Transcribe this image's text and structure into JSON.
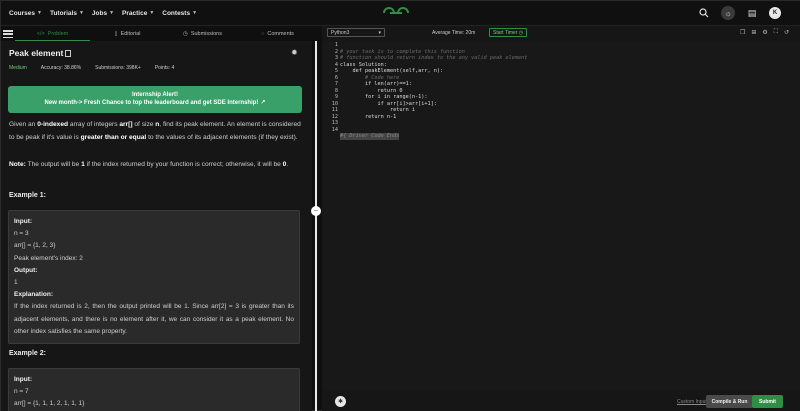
{
  "nav": {
    "items": [
      "Courses",
      "Tutorials",
      "Jobs",
      "Practice",
      "Contests"
    ],
    "logo_text": "GfG",
    "avatar_letter": "K"
  },
  "tabs": [
    {
      "label": "Problem",
      "icon": "code-icon"
    },
    {
      "label": "Editorial",
      "icon": "book-icon"
    },
    {
      "label": "Submissions",
      "icon": "clock-icon"
    },
    {
      "label": "Comments",
      "icon": "comment-icon"
    }
  ],
  "problem": {
    "title": "Peak element",
    "difficulty": "Medium",
    "accuracy": "Accuracy: 38.86%",
    "submissions": "Submissions: 398K+",
    "points": "Points: 4"
  },
  "banner": {
    "line1": "Internship Alert!",
    "line2": "New month-> Fresh Chance to top the leaderboard and get SDE Internship!"
  },
  "description": {
    "p1_a": "Given an ",
    "p1_b": "0-indexed",
    "p1_c": " array of integers ",
    "p1_d": "arr[]",
    "p1_e": " of size ",
    "p1_f": "n",
    "p1_g": ", find its peak element. An element is considered to be peak if it's value is ",
    "p1_h": "greater than or equal",
    "p1_i": " to the values of its adjacent elements (if they exist).",
    "note_label": "Note:",
    "note_a": " The output will be ",
    "note_b": "1",
    "note_c": " if the index returned by your function is correct; otherwise, it will be ",
    "note_d": "0",
    "note_e": "."
  },
  "example1": {
    "heading": "Example 1:",
    "input_label": "Input:",
    "line1": "n = 3",
    "line2": "arr[] = {1, 2, 3}",
    "line3": "Peak element's index: 2",
    "output_label": "Output:",
    "output": "1",
    "expl_label": "Explanation:",
    "explanation": "If the index returned is 2, then the output printed will be 1. Since arr[2] = 3 is greater than its adjacent elements, and there is no element after it, we can consider it as a peak element. No other index satisfies the same property."
  },
  "example2": {
    "heading": "Example 2:",
    "input_label": "Input:",
    "line1": "n = 7",
    "line2": "arr[] = {1, 1, 1, 2, 1, 1, 1}"
  },
  "editor": {
    "language": "Python3",
    "avg_time": "Average Time: 20m",
    "timer_label": "Start Timer",
    "line_numbers": [
      "1",
      "2",
      "3",
      "4",
      "5",
      "6",
      "7",
      "8",
      "9",
      "10",
      "11",
      "12",
      "13",
      "14"
    ],
    "code_lines": [
      "# your task is to complete this function",
      "# function should return index to the any valid peak element",
      "class Solution:",
      "    def peakElement(self,arr, n):",
      "        # Code here",
      "        if len(arr)==1:",
      "            return 0",
      "        for i in range(n-1):",
      "            if arr[i]>arr[i+1]:",
      "                return i",
      "        return n-1",
      "",
      "",
      "#{ Driver Code Ends"
    ],
    "custom_input": "Custom Input",
    "compile_label": "Compile & Run",
    "submit_label": "Submit"
  },
  "colors": {
    "accent": "#2f8d46",
    "banner": "#3aa06a",
    "background": "#161616"
  }
}
